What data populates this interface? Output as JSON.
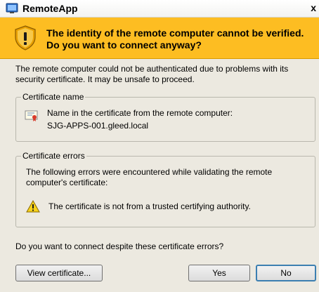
{
  "window": {
    "title": "RemoteApp",
    "close_glyph": "x",
    "app_icon": "remoteapp-icon",
    "close_icon": "close-icon"
  },
  "banner": {
    "icon": "shield-warning-icon",
    "message": "The identity of the remote computer cannot be verified. Do you want to connect anyway?",
    "color": "#fdbd22"
  },
  "intro_text": "The remote computer could not be authenticated due to problems with its security certificate. It may be unsafe to proceed.",
  "certificate_name": {
    "legend": "Certificate name",
    "icon": "certificate-icon",
    "label": "Name in the certificate from the remote computer:",
    "value": "SJG-APPS-001.gleed.local"
  },
  "certificate_errors": {
    "legend": "Certificate errors",
    "intro": "The following errors were encountered while validating the remote computer's certificate:",
    "items": [
      {
        "icon": "warning-icon",
        "text": "The certificate is not from a trusted certifying authority."
      }
    ]
  },
  "question": "Do you want to connect despite these certificate errors?",
  "buttons": {
    "view_certificate": "View certificate...",
    "yes": "Yes",
    "no": "No"
  }
}
